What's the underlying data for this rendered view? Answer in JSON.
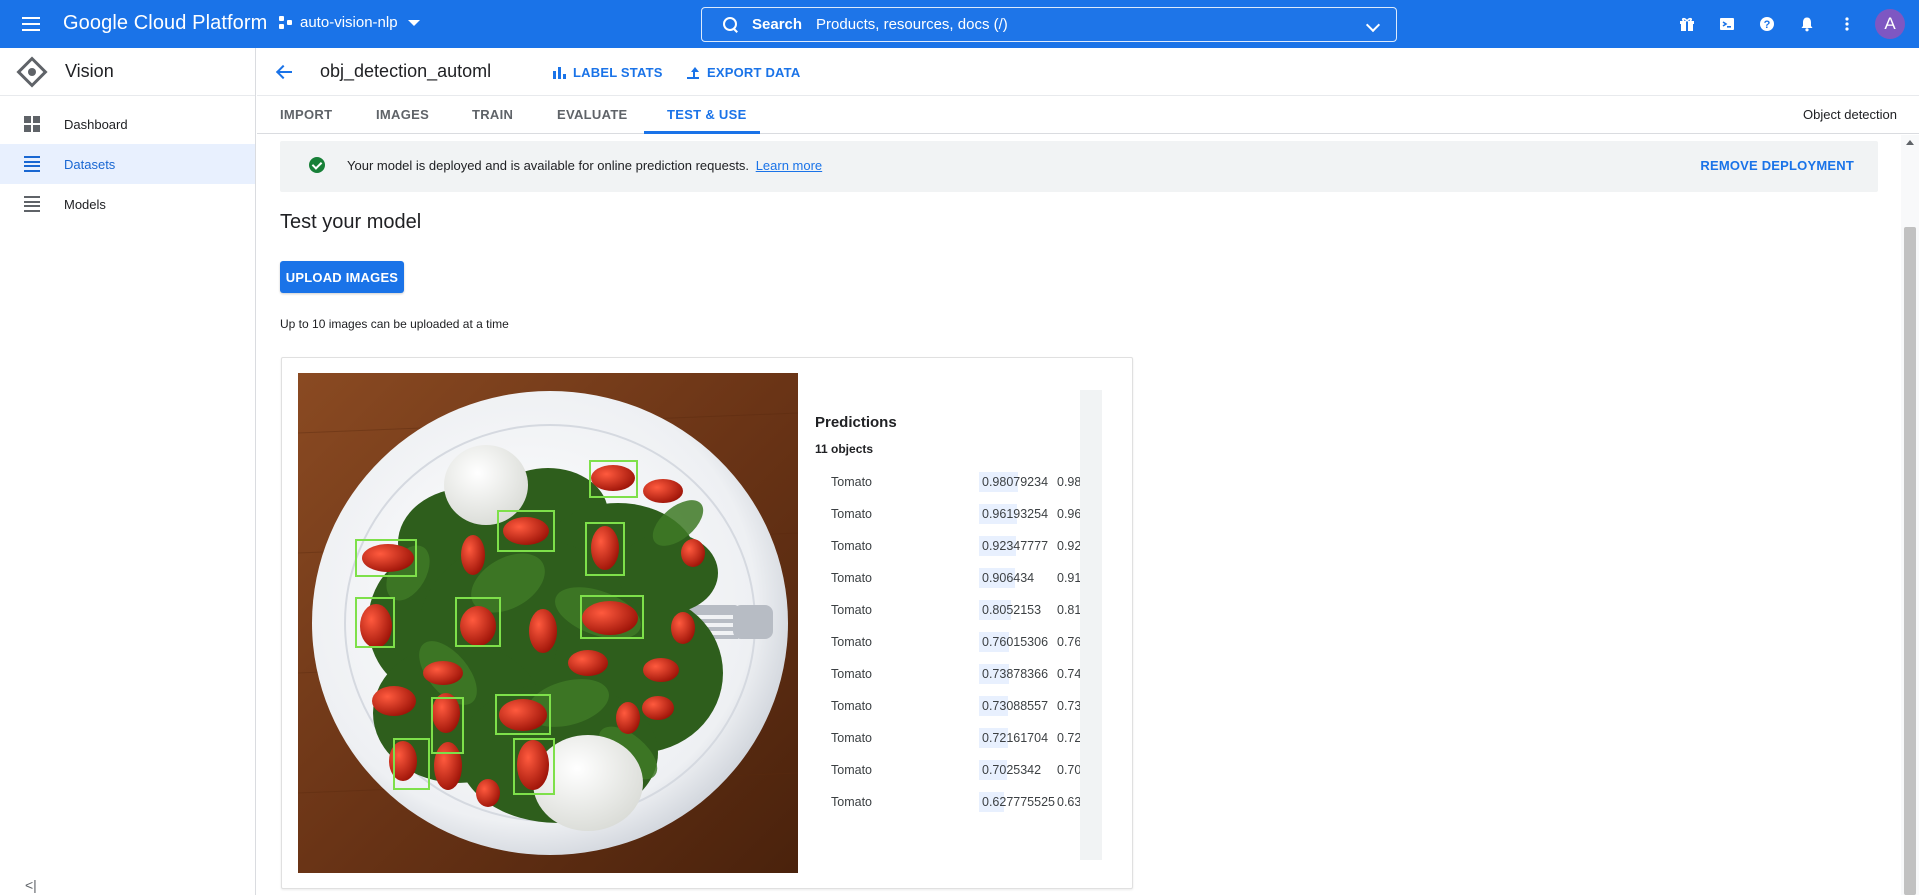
{
  "topbar": {
    "brand": "Google Cloud Platform",
    "project": "auto-vision-nlp",
    "search_label": "Search",
    "search_hint": "Products, resources, docs (/)",
    "avatar_letter": "A"
  },
  "sidebar": {
    "title": "Vision",
    "items": [
      {
        "label": "Dashboard",
        "icon": "dashboard-icon"
      },
      {
        "label": "Datasets",
        "icon": "list-icon"
      },
      {
        "label": "Models",
        "icon": "list-icon"
      }
    ],
    "collapse_glyph": "<|"
  },
  "header": {
    "title": "obj_detection_automl",
    "label_stats": "LABEL STATS",
    "export_data": "EXPORT DATA"
  },
  "tabs": {
    "items": [
      "IMPORT",
      "IMAGES",
      "TRAIN",
      "EVALUATE",
      "TEST & USE"
    ],
    "active": "TEST & USE",
    "kind": "Object detection"
  },
  "banner": {
    "text": "Your model is deployed and is available for online prediction requests.",
    "link": "Learn more",
    "action": "REMOVE DEPLOYMENT"
  },
  "test": {
    "title": "Test your model",
    "upload_button": "UPLOAD IMAGES",
    "upload_hint": "Up to 10 images can be uploaded at a time"
  },
  "predictions": {
    "title": "Predictions",
    "count": "11 objects",
    "rows": [
      {
        "label": "Tomato",
        "score": "0.98079234",
        "rounded": "0.98",
        "fraction": 0.98
      },
      {
        "label": "Tomato",
        "score": "0.96193254",
        "rounded": "0.96",
        "fraction": 0.96
      },
      {
        "label": "Tomato",
        "score": "0.92347777",
        "rounded": "0.92",
        "fraction": 0.92
      },
      {
        "label": "Tomato",
        "score": "0.906434",
        "rounded": "0.91",
        "fraction": 0.91
      },
      {
        "label": "Tomato",
        "score": "0.8052153",
        "rounded": "0.81",
        "fraction": 0.81
      },
      {
        "label": "Tomato",
        "score": "0.76015306",
        "rounded": "0.76",
        "fraction": 0.76
      },
      {
        "label": "Tomato",
        "score": "0.73878366",
        "rounded": "0.74",
        "fraction": 0.74
      },
      {
        "label": "Tomato",
        "score": "0.73088557",
        "rounded": "0.73",
        "fraction": 0.73
      },
      {
        "label": "Tomato",
        "score": "0.72161704",
        "rounded": "0.72",
        "fraction": 0.72
      },
      {
        "label": "Tomato",
        "score": "0.7025342",
        "rounded": "0.70",
        "fraction": 0.7
      },
      {
        "label": "Tomato",
        "score": "0.627775525",
        "rounded": "0.63",
        "fraction": 0.63
      }
    ]
  },
  "colors": {
    "topbar": "#1a73e8",
    "accent": "#1a73e8",
    "success": "#188038",
    "bbox": "#7ee04a"
  }
}
